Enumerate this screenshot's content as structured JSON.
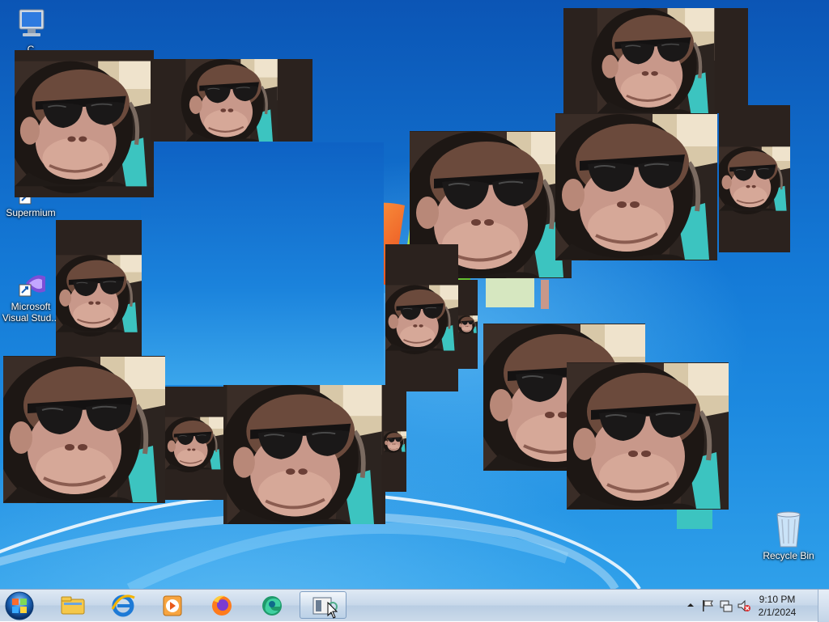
{
  "desktop": {
    "icons": [
      {
        "name": "computer-icon",
        "label": "C"
      },
      {
        "name": "supermium-icon",
        "label": "Supermium"
      },
      {
        "name": "visual-studio-icon",
        "label": "Microsoft Visual Stud..."
      },
      {
        "name": "recycle-bin-icon",
        "label": "Recycle Bin"
      }
    ]
  },
  "taskbar": {
    "start_icon": "windows-orb-icon",
    "pinned": [
      {
        "name": "file-explorer-icon"
      },
      {
        "name": "internet-explorer-icon"
      },
      {
        "name": "media-player-icon"
      },
      {
        "name": "firefox-icon"
      },
      {
        "name": "edge-icon"
      },
      {
        "name": "active-window-icon",
        "active": true
      }
    ],
    "tray": {
      "icons": [
        "show-hidden-icons-icon",
        "action-center-flag-icon",
        "network-icon",
        "volume-muted-icon"
      ],
      "time": "9:10 PM",
      "date": "2/1/2024"
    }
  },
  "colors": {
    "wallpaper_blue": "#1479d6",
    "taskbar": "#c8d8ea",
    "teal_seat": "#3cc4c0"
  }
}
